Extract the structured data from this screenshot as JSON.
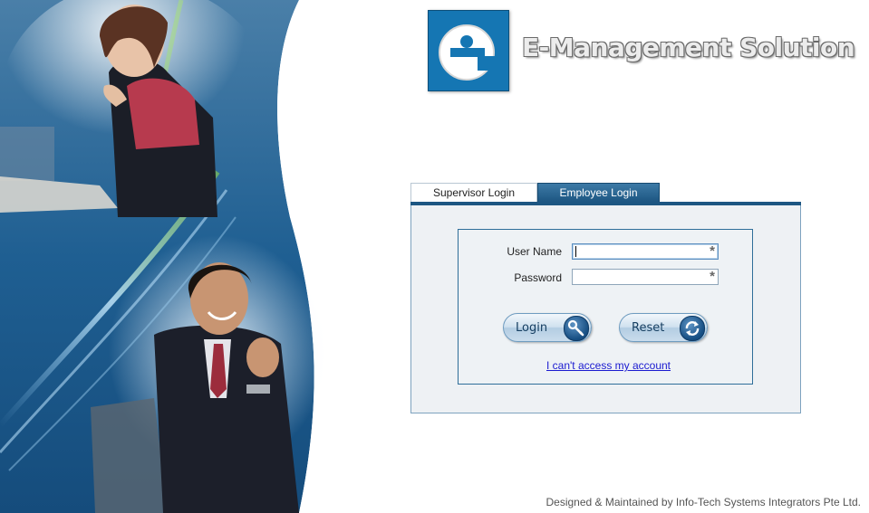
{
  "branding": {
    "title": "E-Management Solution",
    "logo_letter": "e",
    "logo_color": "#1576b3"
  },
  "tabs": [
    {
      "label": "Supervisor Login",
      "active": false
    },
    {
      "label": "Employee Login",
      "active": true
    }
  ],
  "form": {
    "username_label": "User Name",
    "username_value": "",
    "password_label": "Password",
    "password_value": "",
    "required_marker": "*",
    "login_button": "Login",
    "reset_button": "Reset",
    "access_link": "I can't access my account"
  },
  "icons": {
    "login_button_icon": "key-icon",
    "reset_button_icon": "refresh-icon"
  },
  "footer": {
    "text": "Designed & Maintained by Info-Tech Systems Integrators Pte Ltd."
  },
  "colors": {
    "accent": "#1d5682",
    "panel_border": "#7ea3bf",
    "link": "#1a1ad0"
  }
}
